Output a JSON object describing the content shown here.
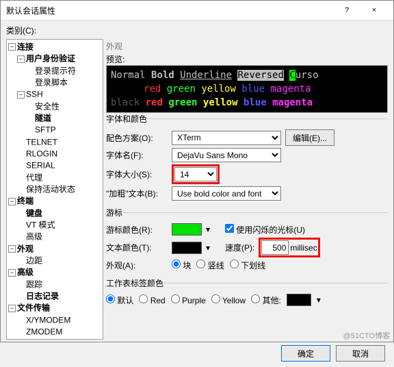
{
  "window": {
    "title": "默认会话属性",
    "help": "?",
    "close": "×"
  },
  "category_label": "类别(C):",
  "tree": [
    {
      "d": 0,
      "t": "连接",
      "bold": true,
      "exp": true
    },
    {
      "d": 1,
      "t": "用户身份验证",
      "bold": true,
      "exp": true
    },
    {
      "d": 2,
      "t": "登录提示符"
    },
    {
      "d": 2,
      "t": "登录脚本"
    },
    {
      "d": 1,
      "t": "SSH",
      "exp": true
    },
    {
      "d": 2,
      "t": "安全性"
    },
    {
      "d": 2,
      "t": "隧道",
      "bold": true
    },
    {
      "d": 2,
      "t": "SFTP"
    },
    {
      "d": 1,
      "t": "TELNET"
    },
    {
      "d": 1,
      "t": "RLOGIN"
    },
    {
      "d": 1,
      "t": "SERIAL"
    },
    {
      "d": 1,
      "t": "代理"
    },
    {
      "d": 1,
      "t": "保持活动状态"
    },
    {
      "d": 0,
      "t": "终端",
      "bold": true,
      "exp": true
    },
    {
      "d": 1,
      "t": "键盘",
      "bold": true
    },
    {
      "d": 1,
      "t": "VT 模式"
    },
    {
      "d": 1,
      "t": "高级"
    },
    {
      "d": 0,
      "t": "外观",
      "bold": true,
      "exp": true
    },
    {
      "d": 1,
      "t": "边距"
    },
    {
      "d": 0,
      "t": "高级",
      "bold": true,
      "exp": true
    },
    {
      "d": 1,
      "t": "跟踪"
    },
    {
      "d": 1,
      "t": "日志记录",
      "bold": true
    },
    {
      "d": 0,
      "t": "文件传输",
      "bold": true,
      "exp": true
    },
    {
      "d": 1,
      "t": "X/YMODEM"
    },
    {
      "d": 1,
      "t": "ZMODEM"
    }
  ],
  "appearance_header": "外观",
  "preview_label": "预览:",
  "preview": {
    "row1": [
      "Normal",
      "Bold",
      "Underline",
      "Reversed",
      "C",
      "urso"
    ],
    "colors": [
      "red",
      "green",
      "yellow",
      "blue",
      "magenta"
    ],
    "black": "black"
  },
  "font_section": "字体和颜色",
  "scheme_label": "配色方案(O):",
  "scheme_value": "XTerm",
  "edit_btn": "编辑(E)...",
  "fontname_label": "字体名(F):",
  "fontname_value": "DejaVu Sans Mono",
  "fontsize_label": "字体大小(S):",
  "fontsize_value": "14",
  "boldtext_label": "\"加粗\"文本(B):",
  "boldtext_value": "Use bold color and font",
  "cursor_section": "游标",
  "cursor_color_label": "游标颜色(R):",
  "blink_label": "使用闪烁的光标(U)",
  "blink_checked": true,
  "text_color_label": "文本颜色(T):",
  "speed_label": "速度(P):",
  "speed_value": "500",
  "speed_unit": "millisec",
  "shape_label": "外观(A):",
  "shape_block": "块",
  "shape_vline": "竖线",
  "shape_uline": "下划线",
  "sheet_section": "工作表标签颜色",
  "sheet_default": "默认",
  "sheet_red": "Red",
  "sheet_purple": "Purple",
  "sheet_yellow": "Yellow",
  "sheet_other": "其他:",
  "ok": "确定",
  "cancel": "取消",
  "watermark": "@51CTO博客"
}
